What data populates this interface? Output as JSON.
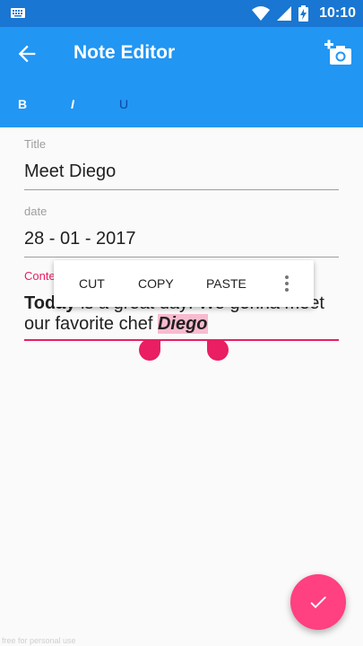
{
  "status_bar": {
    "time": "10:10",
    "icons": [
      "keyboard-icon",
      "wifi-icon",
      "signal-icon",
      "battery-charging-icon"
    ]
  },
  "app_bar": {
    "title": "Note Editor",
    "back_icon": "arrow-back-icon",
    "action_icon": "add-photo-icon"
  },
  "format_bar": {
    "bold": "B",
    "italic": "I",
    "underline": "U"
  },
  "form": {
    "title_label": "Title",
    "title_value": "Meet Diego",
    "date_label": "date",
    "date_value": "28 - 01 - 2017",
    "content_label": "Conte",
    "content": {
      "bold_prefix": "Today",
      "text": " is a great day! We gonna meet our favorite chef ",
      "selected": "Diego"
    }
  },
  "context_menu": {
    "cut": "CUT",
    "copy": "COPY",
    "paste": "PASTE"
  },
  "fab": {
    "icon": "check-icon"
  },
  "watermark": "free for personal use",
  "colors": {
    "primary": "#2196f3",
    "primary_dark": "#1976d2",
    "accent": "#ff4081",
    "focus": "#e91e63",
    "selection": "#f8bbd0"
  }
}
